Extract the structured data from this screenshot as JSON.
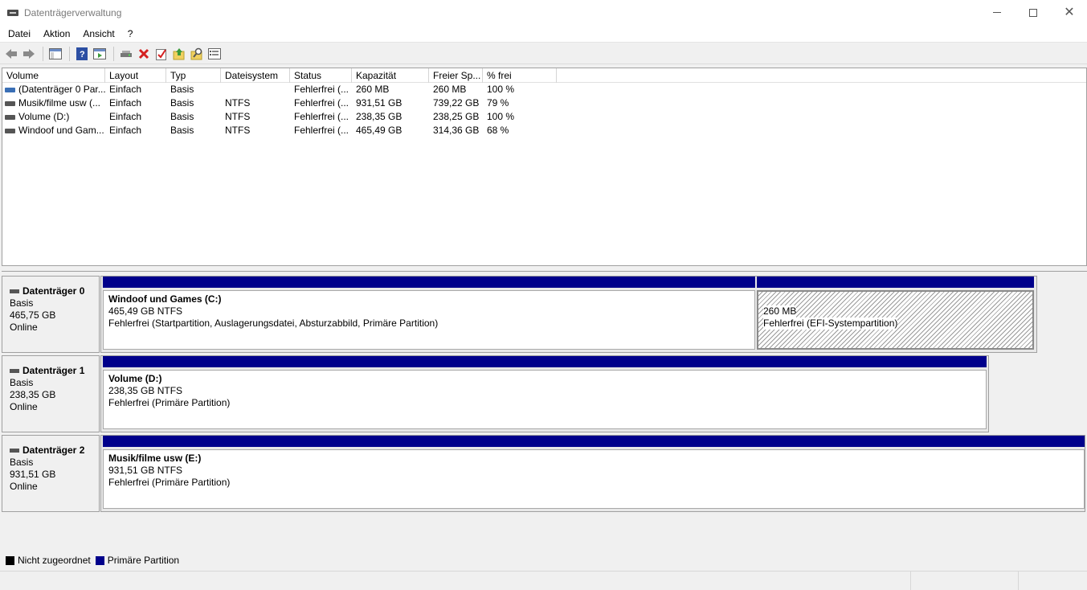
{
  "window": {
    "title": "Datenträgerverwaltung"
  },
  "menu": [
    "Datei",
    "Aktion",
    "Ansicht",
    "?"
  ],
  "columns": [
    "Volume",
    "Layout",
    "Typ",
    "Dateisystem",
    "Status",
    "Kapazität",
    "Freier Sp...",
    "% frei"
  ],
  "volumes": [
    [
      "(Datenträger 0 Par...",
      "Einfach",
      "Basis",
      "",
      "Fehlerfrei (...",
      "260 MB",
      "260 MB",
      "100 %"
    ],
    [
      "Musik/filme usw (...",
      "Einfach",
      "Basis",
      "NTFS",
      "Fehlerfrei (...",
      "931,51 GB",
      "739,22 GB",
      "79 %"
    ],
    [
      "Volume (D:)",
      "Einfach",
      "Basis",
      "NTFS",
      "Fehlerfrei (...",
      "238,35 GB",
      "238,25 GB",
      "100 %"
    ],
    [
      "Windoof und Gam...",
      "Einfach",
      "Basis",
      "NTFS",
      "Fehlerfrei (...",
      "465,49 GB",
      "314,36 GB",
      "68 %"
    ]
  ],
  "disks": [
    {
      "name": "Datenträger 0",
      "type": "Basis",
      "size": "465,75 GB",
      "state": "Online",
      "partitions": [
        {
          "label": "Windoof und Games  (C:)",
          "size": "465,49 GB NTFS",
          "status": "Fehlerfrei (Startpartition, Auslagerungsdatei, Absturzabbild, Primäre Partition)"
        },
        {
          "label": "",
          "size": "260 MB",
          "status": "Fehlerfrei (EFI-Systempartition)"
        }
      ]
    },
    {
      "name": "Datenträger 1",
      "type": "Basis",
      "size": "238,35 GB",
      "state": "Online",
      "partitions": [
        {
          "label": "Volume  (D:)",
          "size": "238,35 GB NTFS",
          "status": "Fehlerfrei (Primäre Partition)"
        }
      ]
    },
    {
      "name": "Datenträger 2",
      "type": "Basis",
      "size": "931,51 GB",
      "state": "Online",
      "partitions": [
        {
          "label": "Musik/filme usw  (E:)",
          "size": "931,51 GB NTFS",
          "status": "Fehlerfrei (Primäre Partition)"
        }
      ]
    }
  ],
  "legend": [
    {
      "label": "Nicht zugeordnet",
      "color": "#000000"
    },
    {
      "label": "Primäre Partition",
      "color": "#00008b"
    }
  ],
  "icons": [
    "back-icon",
    "forward-icon",
    "console-tree-icon",
    "help-icon",
    "action-pane-icon",
    "connect-disk-icon",
    "delete-icon",
    "properties-icon",
    "export-icon",
    "search-icon",
    "show-list-icon"
  ]
}
